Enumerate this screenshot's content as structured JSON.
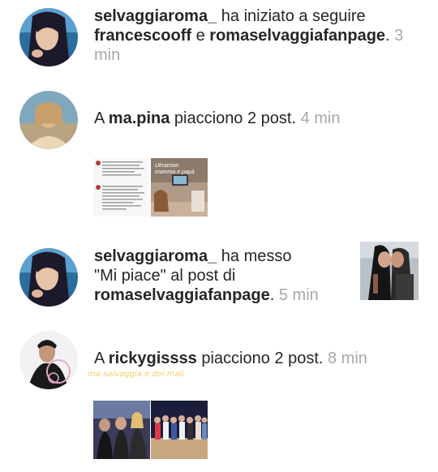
{
  "notifications": [
    {
      "user": "selvaggiaroma_",
      "action": " ha iniziato a seguire",
      "target1": "francescooff",
      "conj": " e ",
      "target2": "romaselvaggiafanpage",
      "end": ".",
      "time": "3 min"
    },
    {
      "prefix": "A ",
      "user": "ma.pina",
      "action": " piacciono 2 post.",
      "time": "4 min",
      "thumb_text": [
        "Ukrainian",
        "mamma e papà"
      ]
    },
    {
      "user": "selvaggiaroma_",
      "action_line1": " ha messo",
      "action_line2": "\"Mi piace\" al post di",
      "target": "romaselvaggiafanpage",
      "end": ".",
      "time": "5 min"
    },
    {
      "prefix": "A ",
      "user": "rickygissss",
      "action": " piacciono 2 post.",
      "time": "8 min",
      "watermark": "ma salvaggia e dei mali"
    }
  ],
  "colors": {
    "text": "#262626",
    "time": "#a8a8a8",
    "background": "#ffffff"
  }
}
